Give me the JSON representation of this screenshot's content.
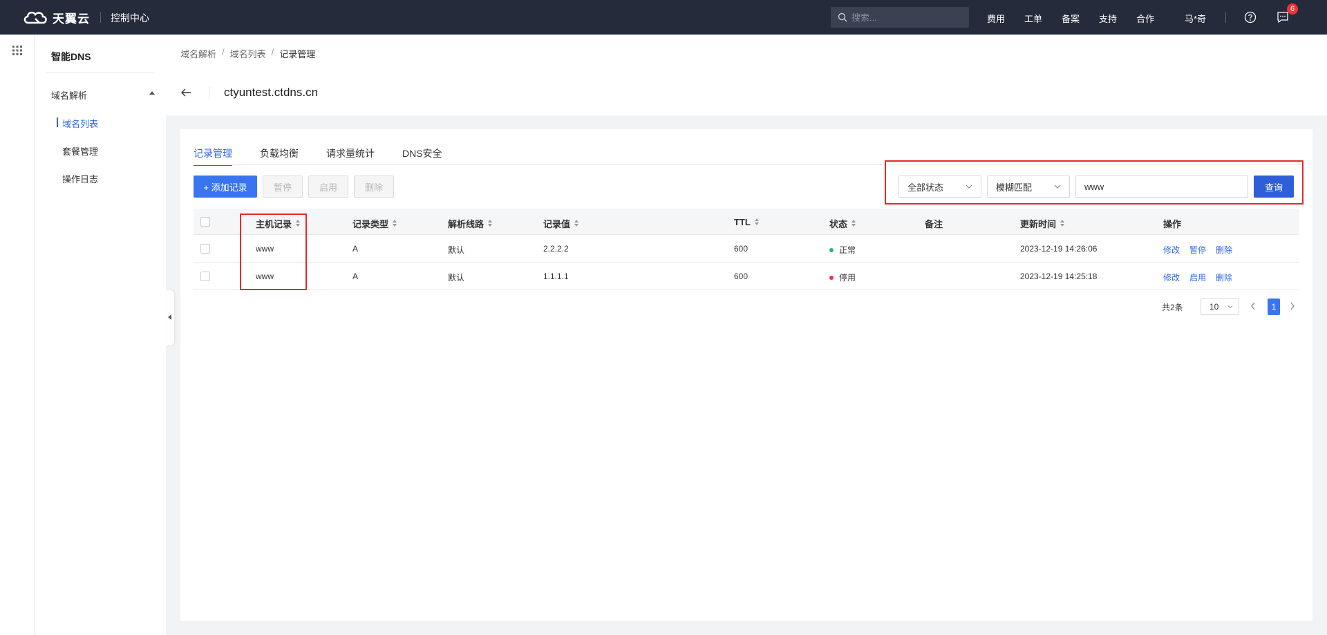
{
  "topbar": {
    "brand": "天翼云",
    "console": "控制中心",
    "search_placeholder": "搜索...",
    "links": [
      "费用",
      "工单",
      "备案",
      "支持",
      "合作"
    ],
    "user": "马*奇",
    "message_count": "6"
  },
  "sidenav": {
    "title": "智能DNS",
    "group": "域名解析",
    "items": [
      "域名列表",
      "套餐管理",
      "操作日志"
    ]
  },
  "breadcrumb": [
    "域名解析",
    "域名列表",
    "记录管理"
  ],
  "page_title": "ctyuntest.ctdns.cn",
  "tabs": [
    "记录管理",
    "负载均衡",
    "请求量统计",
    "DNS安全"
  ],
  "toolbar": {
    "add": "+ 添加记录",
    "pause": "暂停",
    "enable": "启用",
    "delete": "删除"
  },
  "filters": {
    "status": "全部状态",
    "match": "模糊匹配",
    "keyword": "www",
    "query": "查询"
  },
  "table": {
    "columns": [
      "主机记录",
      "记录类型",
      "解析线路",
      "记录值",
      "TTL",
      "状态",
      "备注",
      "更新时间",
      "操作"
    ],
    "rows": [
      {
        "host": "www",
        "type": "A",
        "line": "默认",
        "value": "2.2.2.2",
        "ttl": "600",
        "status": "正常",
        "status_color": "#2bb862",
        "remark": "",
        "updated": "2023-12-19 14:26:06",
        "actions": [
          "修改",
          "暂停",
          "删除"
        ]
      },
      {
        "host": "www",
        "type": "A",
        "line": "默认",
        "value": "1.1.1.1",
        "ttl": "600",
        "status": "停用",
        "status_color": "#f2303a",
        "remark": "",
        "updated": "2023-12-19 14:25:18",
        "actions": [
          "修改",
          "启用",
          "删除"
        ]
      }
    ]
  },
  "pagination": {
    "total": "共2条",
    "page_size": "10",
    "current_page": "1"
  }
}
